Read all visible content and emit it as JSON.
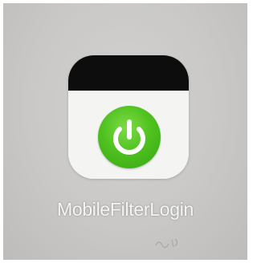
{
  "app": {
    "label": "MobileFilterLogin",
    "icon": "power-icon",
    "colors": {
      "header": "#0d0d0d",
      "body": "#f4f4f2",
      "button_green": "#4fc21f",
      "label_text": "#f5f5f5",
      "background": "#c9c8c6"
    }
  }
}
